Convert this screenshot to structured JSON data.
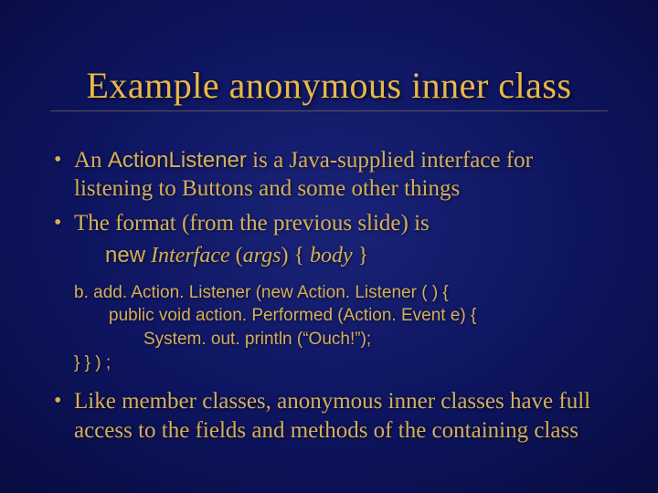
{
  "title": "Example anonymous inner class",
  "bullets": {
    "b1_prefix": "An ",
    "b1_code": "ActionListener",
    "b1_suffix": " is a Java-supplied interface for listening to Buttons and some other things",
    "b2": "The format (from the previous slide) is",
    "b3": "Like member classes, anonymous inner classes have full access to the fields and methods of the containing class"
  },
  "syntax": {
    "kw_new": "new",
    "intf": " Interface ",
    "paren_open": "(",
    "args": "args",
    "paren_close": ") { ",
    "body": "body",
    "close": " }"
  },
  "code": {
    "l1": "b. add. Action. Listener  (new  Action. Listener  ( ) {",
    "l2": "public void action. Performed (Action. Event e) {",
    "l3": "System. out. println (“Ouch!”);",
    "l4": "} } ) ;"
  }
}
